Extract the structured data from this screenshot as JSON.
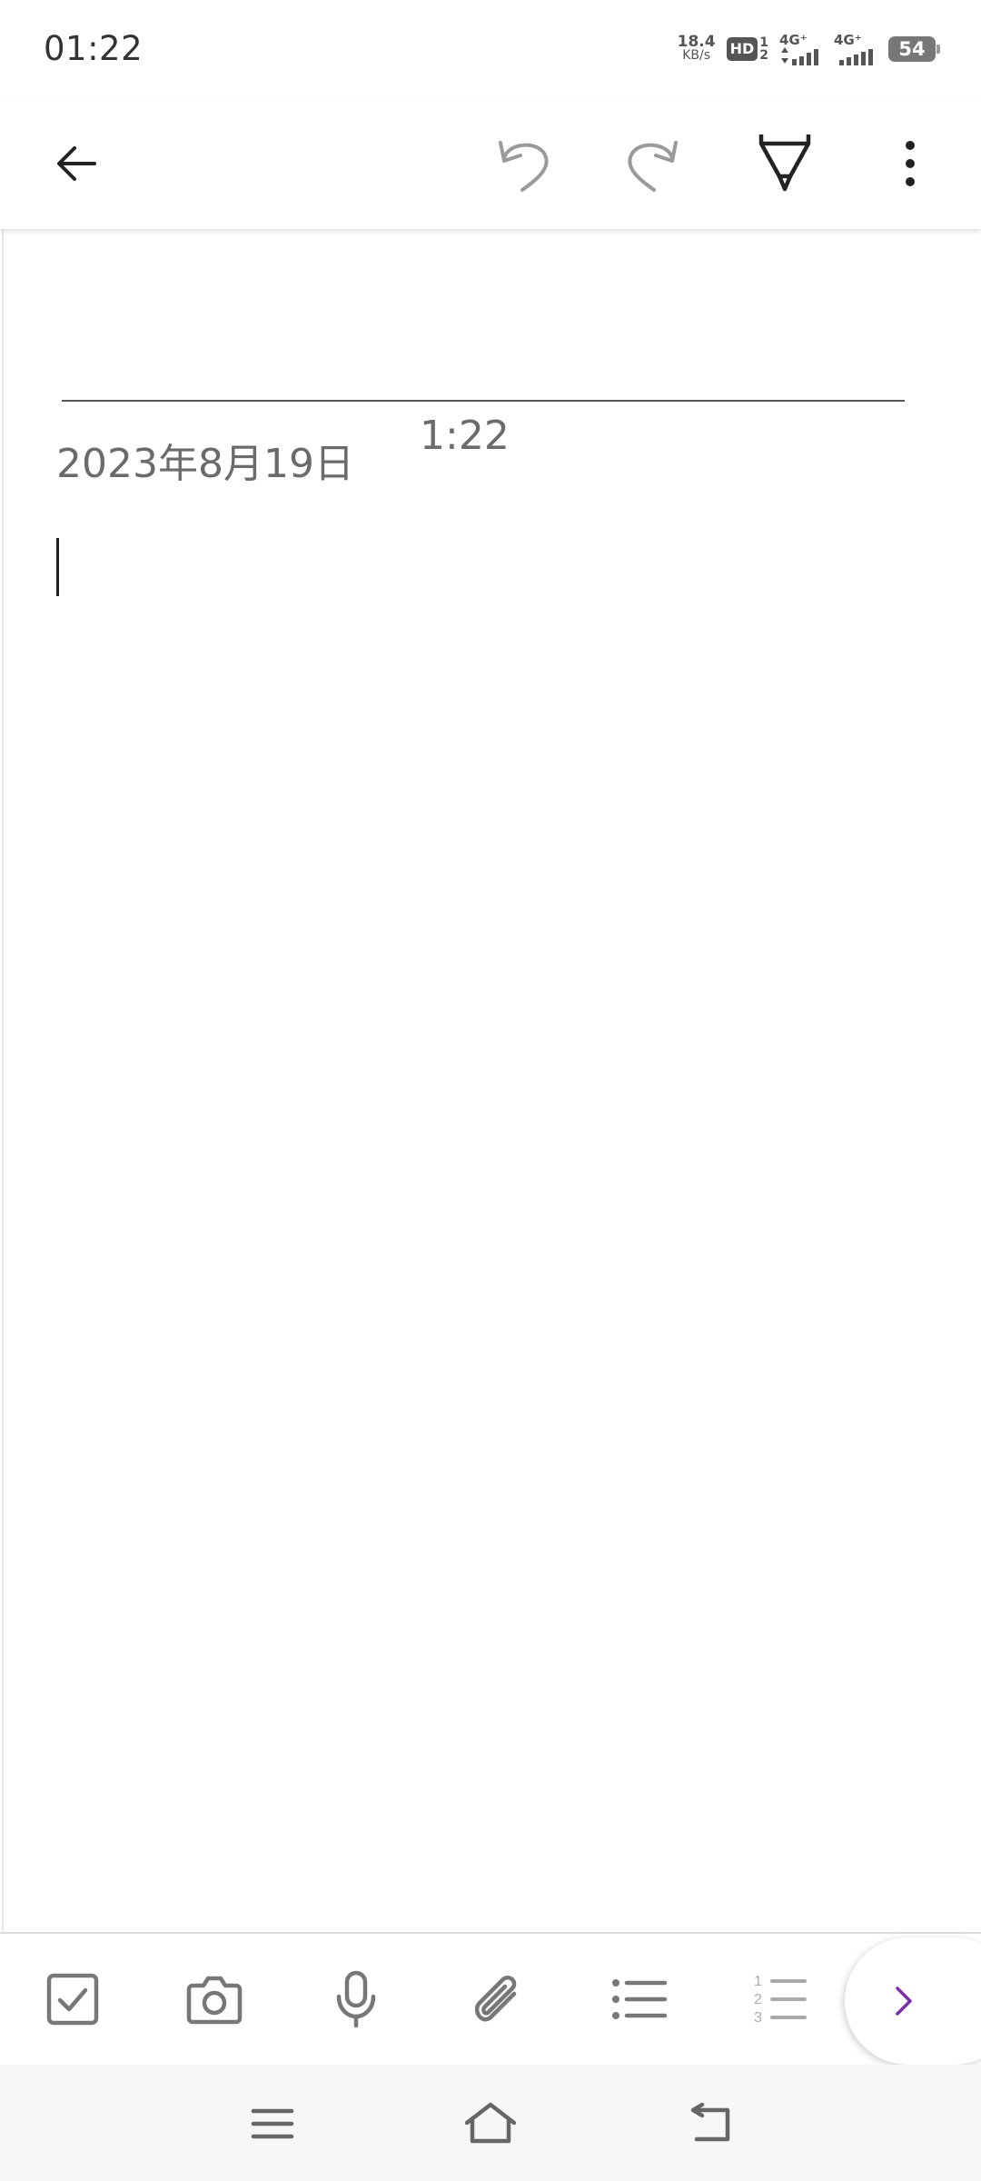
{
  "status_bar": {
    "time": "01:22",
    "net_speed_value": "18.4",
    "net_speed_unit": "KB/s",
    "hd_label": "HD",
    "hd_sim_top": "1",
    "hd_sim_bottom": "2",
    "sim1_label": "4G⁺",
    "sim2_label": "4G⁺",
    "battery_level": "54"
  },
  "toolbar": {
    "back_icon": "arrow-left-icon",
    "undo_icon": "undo-icon",
    "redo_icon": "redo-icon",
    "pen_icon": "pen-icon",
    "more_icon": "more-vertical-icon"
  },
  "note": {
    "date": "2023年8月19日",
    "time": "1:22",
    "body": ""
  },
  "format_bar": {
    "items": [
      {
        "name": "checkbox",
        "icon": "checkbox-icon"
      },
      {
        "name": "camera",
        "icon": "camera-icon"
      },
      {
        "name": "microphone",
        "icon": "microphone-icon"
      },
      {
        "name": "attachment",
        "icon": "paperclip-icon"
      },
      {
        "name": "bullet-list",
        "icon": "bullet-list-icon"
      },
      {
        "name": "numbered-list",
        "icon": "numbered-list-icon"
      }
    ],
    "numbered_list_digits": [
      "1",
      "2",
      "3"
    ],
    "expand_icon": "chevron-right-icon",
    "accent_color": "#7B2FA8"
  },
  "nav_bar": {
    "menu_icon": "menu-icon",
    "home_icon": "home-icon",
    "back_icon": "back-icon"
  }
}
